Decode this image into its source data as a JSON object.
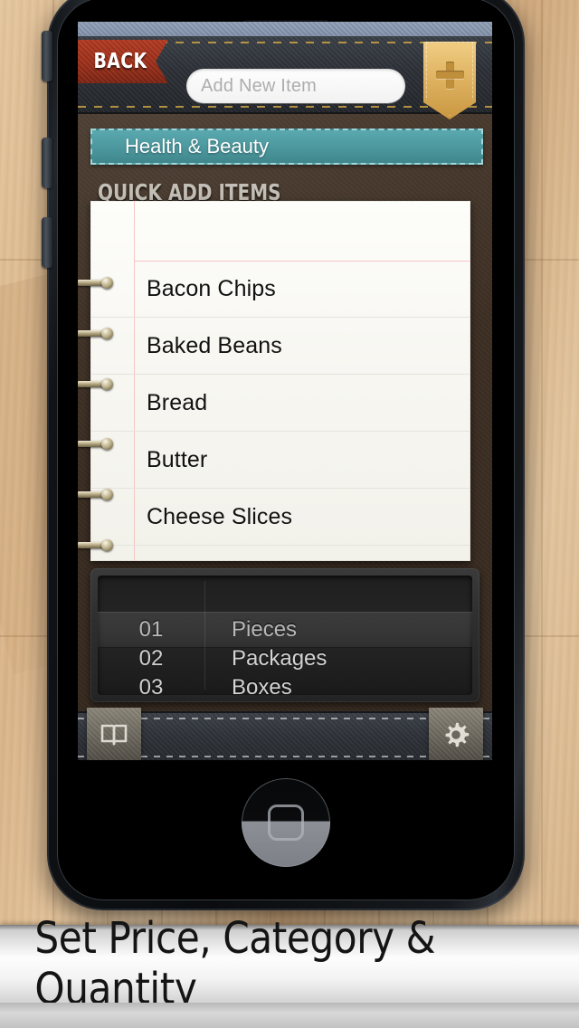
{
  "screen": {
    "nav": {
      "back_label": "BACK",
      "add_placeholder": "Add New Item",
      "plus_icon": "plus-icon"
    },
    "category_bar": {
      "label": "Health & Beauty"
    },
    "section_heading": "QUICK ADD ITEMS",
    "quick_add_items": [
      "Bacon Chips",
      "Baked Beans",
      "Bread",
      "Butter",
      "Cheese Slices"
    ],
    "picker": {
      "rows": [
        {
          "number": "01",
          "unit": "Pieces"
        },
        {
          "number": "02",
          "unit": "Packages"
        },
        {
          "number": "03",
          "unit": "Boxes"
        }
      ],
      "selected_index": 0
    },
    "toolbar": {
      "left_icon": "book-icon",
      "right_icon": "gear-icon"
    }
  },
  "caption": {
    "text": "Set Price, Category & Quantity"
  },
  "colors": {
    "accent_teal": "#4b979d",
    "back_red": "#9c2f1a",
    "gold": "#e0b463",
    "leather_brown": "#3c2e23",
    "navbar_dark": "#2d3137",
    "paper": "#fdfdfa",
    "picker_dark": "#242424"
  }
}
